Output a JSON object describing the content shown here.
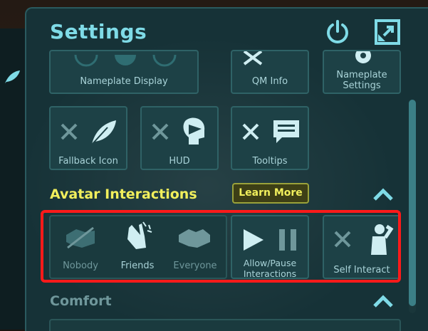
{
  "window": {
    "title": "Settings"
  },
  "header": {
    "power_icon": "power-icon",
    "expand_icon": "expand-icon"
  },
  "top_row": [
    {
      "label": "Nameplate Display"
    },
    {
      "label": "QM Info"
    },
    {
      "label": "Nameplate Settings"
    }
  ],
  "second_row": [
    {
      "label": "Fallback Icon",
      "state": "off"
    },
    {
      "label": "HUD",
      "state": "off"
    },
    {
      "label": "Tooltips",
      "state": "off"
    }
  ],
  "avatar_interactions": {
    "title": "Avatar Interactions",
    "learn_more": "Learn More",
    "options": [
      {
        "label": "Nobody"
      },
      {
        "label": "Friends"
      },
      {
        "label": "Everyone"
      }
    ],
    "allow_pause": "Allow/Pause Interactions",
    "self_interact": "Self Interact"
  },
  "comfort": {
    "title": "Comfort"
  },
  "colors": {
    "accent": "#7fdbe7",
    "section_yellow": "#f1ef5c",
    "highlight": "#ff1a1a"
  }
}
